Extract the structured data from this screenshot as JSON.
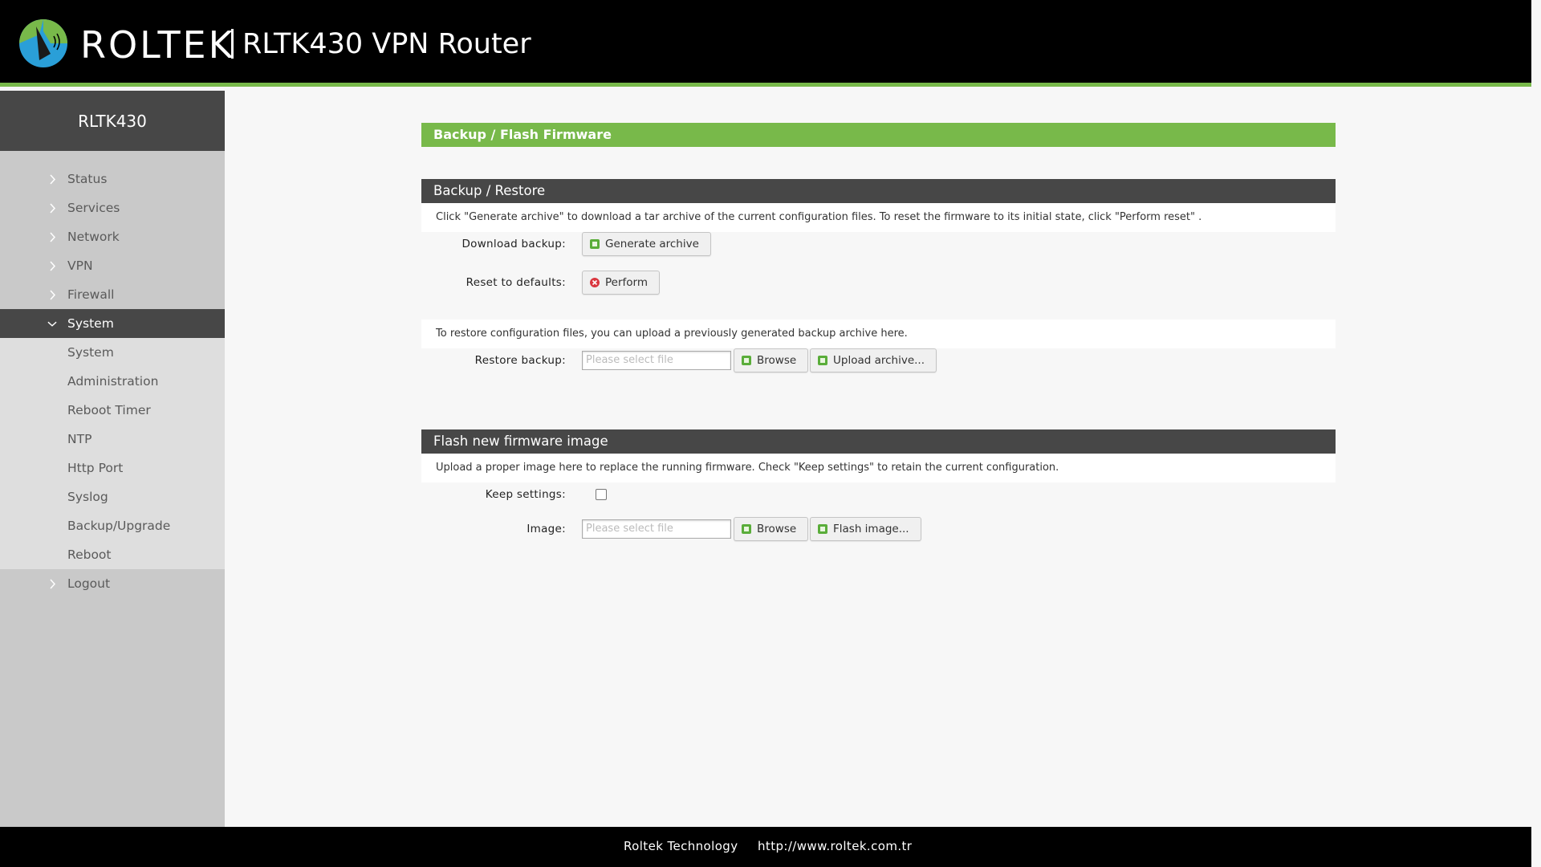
{
  "header": {
    "brand": "ROLTEK",
    "title": "RLTK430 VPN Router",
    "logo_icon": "roltek-logo-icon"
  },
  "sidebar": {
    "device_name": "RLTK430",
    "items": [
      {
        "label": "Status"
      },
      {
        "label": "Services"
      },
      {
        "label": "Network"
      },
      {
        "label": "VPN"
      },
      {
        "label": "Firewall"
      },
      {
        "label": "System",
        "active": true
      }
    ],
    "system_subitems": [
      {
        "label": "System"
      },
      {
        "label": "Administration"
      },
      {
        "label": "Reboot Timer"
      },
      {
        "label": "NTP"
      },
      {
        "label": "Http Port"
      },
      {
        "label": "Syslog"
      },
      {
        "label": "Backup/Upgrade"
      },
      {
        "label": "Reboot"
      }
    ],
    "logout": "Logout"
  },
  "main": {
    "page_title": "Backup / Flash Firmware",
    "backup": {
      "heading": "Backup / Restore",
      "description": "Click \"Generate archive\" to download a tar archive of the current configuration files. To reset the firmware to its initial state, click \"Perform reset\" .",
      "download_label": "Download backup:",
      "generate_button": "Generate archive",
      "reset_label": "Reset to defaults:",
      "perform_button": "Perform",
      "restore_description": "To restore configuration files, you can upload a previously generated backup archive here.",
      "restore_label": "Restore backup:",
      "restore_placeholder": "Please select file",
      "browse_button": "Browse",
      "upload_button": "Upload archive..."
    },
    "flash": {
      "heading": "Flash new firmware image",
      "description": "Upload a proper image here to replace the running firmware. Check \"Keep settings\" to retain the current configuration.",
      "keep_label": "Keep settings:",
      "keep_checked": false,
      "image_label": "Image:",
      "image_placeholder": "Please select file",
      "browse_button": "Browse",
      "flash_button": "Flash image..."
    }
  },
  "footer": {
    "company": "Roltek Technology",
    "url": "http://www.roltek.com.tr"
  },
  "colors": {
    "accent_green": "#78b94a",
    "dark_gray": "#474747",
    "sidebar_gray": "#c9c9c9"
  }
}
